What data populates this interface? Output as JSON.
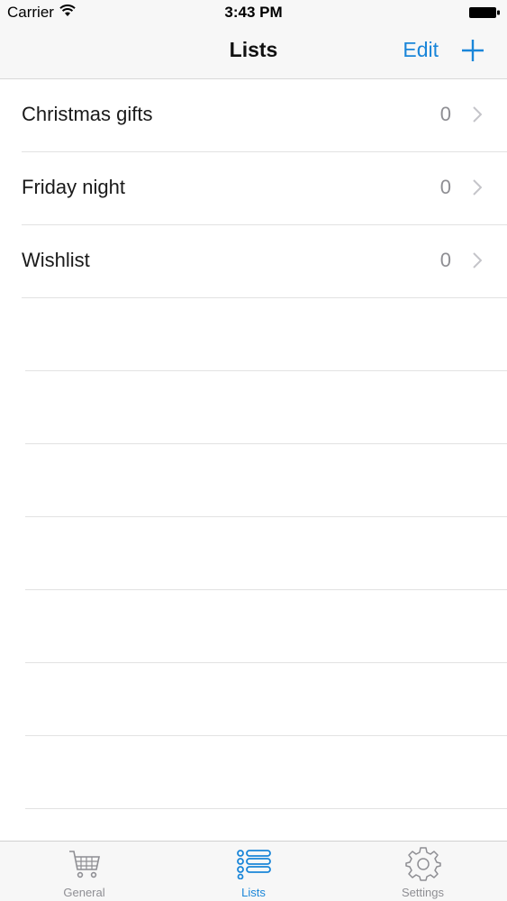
{
  "status_bar": {
    "carrier": "Carrier",
    "time": "3:43 PM"
  },
  "nav": {
    "title": "Lists",
    "edit_label": "Edit",
    "add_icon": "plus-icon"
  },
  "lists": [
    {
      "name": "Christmas gifts",
      "count": "0"
    },
    {
      "name": "Friday night",
      "count": "0"
    },
    {
      "name": "Wishlist",
      "count": "0"
    }
  ],
  "tab_bar": {
    "tabs": [
      {
        "label": "General",
        "icon": "cart-icon",
        "active": false
      },
      {
        "label": "Lists",
        "icon": "list-icon",
        "active": true
      },
      {
        "label": "Settings",
        "icon": "gear-icon",
        "active": false
      }
    ]
  },
  "colors": {
    "accent": "#1a86d9",
    "secondary_text": "#8e8e93",
    "separator": "#e2e2e2",
    "bar_background": "#f7f7f7"
  }
}
